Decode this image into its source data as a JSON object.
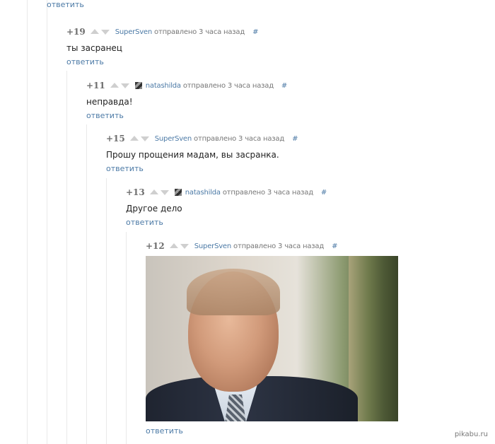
{
  "top_reply": "ответить",
  "comments": [
    {
      "score": "+19",
      "author": "SuperSven",
      "sent": "отправлено 3 часа назад",
      "hash": "#",
      "text": "ты засранец",
      "reply": "ответить"
    },
    {
      "score": "+11",
      "author": "natashilda",
      "sent": "отправлено 3 часа назад",
      "hash": "#",
      "text": "неправда!",
      "reply": "ответить"
    },
    {
      "score": "+15",
      "author": "SuperSven",
      "sent": "отправлено 3 часа назад",
      "hash": "#",
      "text": "Прошу прощения мадам, вы засранка.",
      "reply": "ответить"
    },
    {
      "score": "+13",
      "author": "natashilda",
      "sent": "отправлено 3 часа назад",
      "hash": "#",
      "text": "Другое дело",
      "reply": "ответить"
    },
    {
      "score": "+12",
      "author": "SuperSven",
      "sent": "отправлено 3 часа назад",
      "hash": "#",
      "reply": "ответить"
    }
  ],
  "watermark": "pikabu.ru"
}
